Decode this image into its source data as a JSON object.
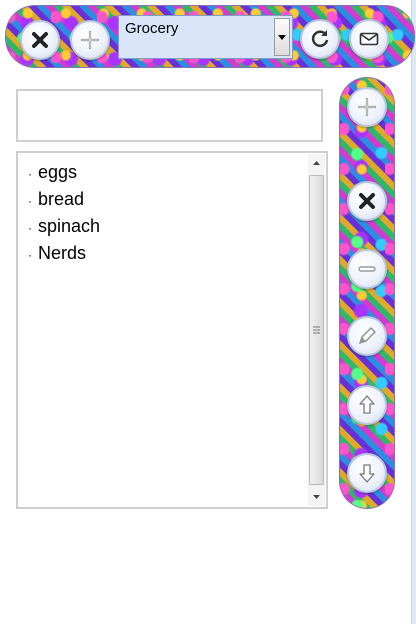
{
  "toolbar": {
    "list_selector": {
      "selected": "Grocery"
    },
    "buttons": [
      {
        "name": "close-list-button",
        "icon": "close-icon"
      },
      {
        "name": "add-list-button",
        "icon": "plus-icon"
      },
      {
        "name": "refresh-button",
        "icon": "refresh-icon"
      },
      {
        "name": "email-button",
        "icon": "mail-icon"
      }
    ]
  },
  "item_input": {
    "value": ""
  },
  "list": {
    "bullet": "·",
    "items": [
      {
        "label": "eggs"
      },
      {
        "label": "bread"
      },
      {
        "label": "spinach"
      },
      {
        "label": "Nerds"
      }
    ]
  },
  "sidebar": {
    "buttons": [
      {
        "name": "add-item-button",
        "icon": "plus-icon"
      },
      {
        "name": "delete-item-button",
        "icon": "close-icon"
      },
      {
        "name": "remove-item-button",
        "icon": "minus-icon"
      },
      {
        "name": "edit-item-button",
        "icon": "pencil-icon"
      },
      {
        "name": "move-up-button",
        "icon": "arrow-up-icon"
      },
      {
        "name": "move-down-button",
        "icon": "arrow-down-icon"
      }
    ]
  }
}
